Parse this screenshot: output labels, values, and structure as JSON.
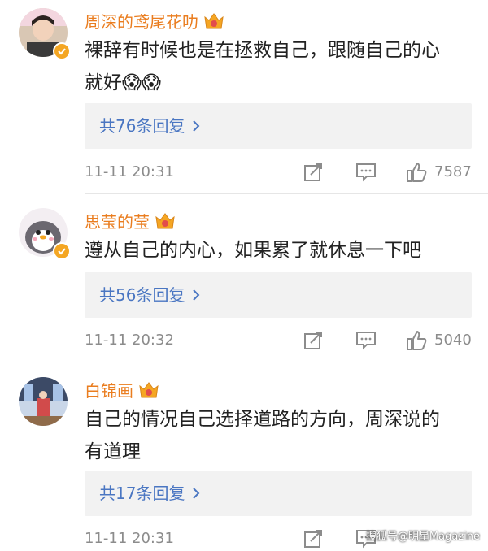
{
  "comments": [
    {
      "username": "周深的鸢尾花叻",
      "text_line1": "裸辞有时候也是在拯救自己，跟随自己的心",
      "text_line2": "就好😱😱",
      "reply_label": "共76条回复",
      "time": "11-11 20:31",
      "likes": "7587"
    },
    {
      "username": "思莹的莹",
      "text_line1": "遵从自己的内心，如果累了就休息一下吧",
      "text_line2": "",
      "reply_label": "共56条回复",
      "time": "11-11 20:32",
      "likes": "5040"
    },
    {
      "username": "白锦画",
      "text_line1": "自己的情况自己选择道路的方向，周深说的",
      "text_line2": "有道理",
      "reply_label": "共17条回复",
      "time": "11-11 20:31",
      "likes": ""
    }
  ],
  "watermark": "搜狐号@明星Magazine",
  "colors": {
    "username": "#ea7d1f",
    "reply_link": "#4a76c2",
    "meta": "#8c8c8c",
    "reply_bg": "#f2f2f2"
  },
  "icons": [
    "crown-badge-icon",
    "verified-badge-icon",
    "chevron-right-icon",
    "share-icon",
    "comment-icon",
    "like-icon"
  ]
}
